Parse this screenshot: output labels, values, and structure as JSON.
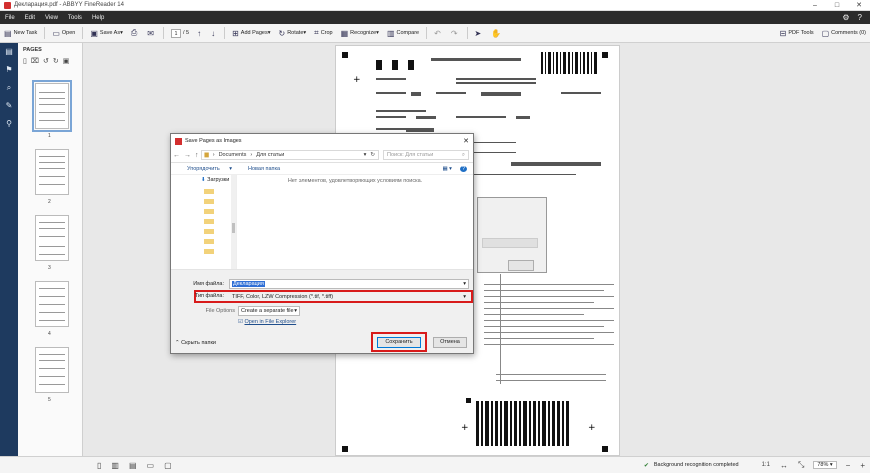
{
  "window": {
    "title": "Декларация.pdf - ABBYY FineReader 14"
  },
  "menu": [
    "File",
    "Edit",
    "View",
    "Tools",
    "Help"
  ],
  "toolbar": {
    "new_task": "New Task",
    "open": "Open",
    "save_as": "Save As",
    "page_current": "1",
    "page_total": "/ 5",
    "add_pages": "Add Pages",
    "rotate": "Rotate",
    "crop": "Crop",
    "recognize": "Recognize",
    "compare": "Compare",
    "pdf_tools": "PDF Tools",
    "comments": "Comments (0)"
  },
  "pages_panel": {
    "title": "PAGES",
    "page_numbers": [
      "1",
      "2",
      "3",
      "4",
      "5"
    ]
  },
  "dialog": {
    "title": "Save Pages as Images",
    "path": [
      "Documents",
      "Для статьи"
    ],
    "search_placeholder": "Поиск: Для статьи",
    "organize": "Упорядочить",
    "new_folder": "Новая папка",
    "tree_item": "Загрузки",
    "empty_message": "Нет элементов, удовлетворяющих условиям поиска.",
    "filename_label": "Имя файла:",
    "filename_value": "Декларация",
    "filetype_label": "Тип файла:",
    "filetype_value": "TIFF, Color, LZW Compression (*.tif, *.tiff)",
    "file_options_label": "File Options",
    "file_options_value": "Create a separate file",
    "open_in_file_explorer": "Open in File Explorer",
    "hide_folders": "Скрыть папки",
    "save_button": "Сохранить",
    "cancel_button": "Отмена"
  },
  "status": {
    "background_recognition": "Background recognition completed",
    "zoom": "78%"
  },
  "colors": {
    "accent": "#d81b1b",
    "sidebar": "#1e3a5f",
    "menubar": "#2b2b2b"
  }
}
